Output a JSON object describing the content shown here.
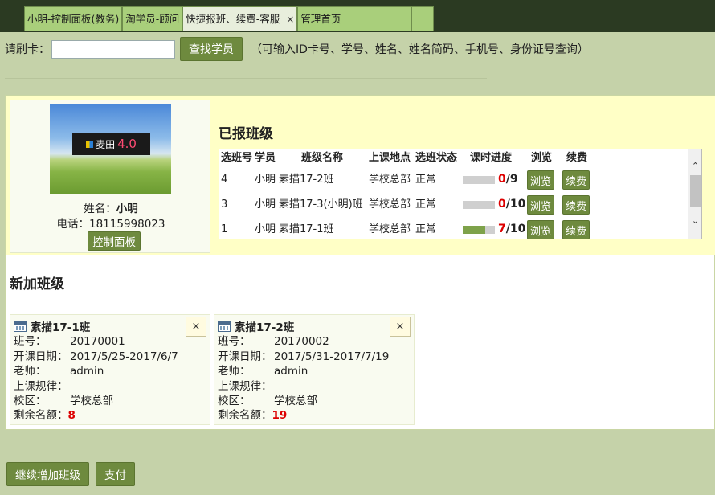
{
  "tabs": [
    {
      "label": "小明-控制面板(教务)",
      "active": false
    },
    {
      "label": "淘学员-顾问",
      "active": false
    },
    {
      "label": "快捷报班、续费-客服",
      "active": true,
      "close": "×"
    },
    {
      "label": "管理首页",
      "active": false
    },
    {
      "label": "",
      "active": false
    }
  ],
  "search": {
    "label": "请刷卡：",
    "value": "",
    "button": "查找学员",
    "hint": "（可输入ID卡号、学号、姓名、姓名简码、手机号、身份证号查询）"
  },
  "student": {
    "image_logo": "麦田",
    "image_version": "4.0",
    "name_label": "姓名：",
    "name": "小明",
    "phone_label": "电话：",
    "phone": "18115998023",
    "panel_button": "控制面板"
  },
  "registered": {
    "title": "已报班级",
    "headers": [
      "选班号",
      "学员",
      "班级名称",
      "上课地点",
      "选班状态",
      "课时进度",
      "浏览",
      "续费"
    ],
    "rows": [
      {
        "no": "4",
        "student": "小明",
        "class": "素描17-2班",
        "location": "学校总部",
        "status": "正常",
        "done": "0",
        "total": "/9",
        "progress": 0.0,
        "view": "浏览",
        "renew": "续费"
      },
      {
        "no": "3",
        "student": "小明",
        "class": "素描17-3(小明)班",
        "location": "学校总部",
        "status": "正常",
        "done": "0",
        "total": "/10",
        "progress": 0.0,
        "view": "浏览",
        "renew": "续费"
      },
      {
        "no": "1",
        "student": "小明",
        "class": "素描17-1班",
        "location": "学校总部",
        "status": "正常",
        "done": "7",
        "total": "/10",
        "progress": 0.7,
        "view": "浏览",
        "renew": "续费"
      }
    ]
  },
  "new_classes": {
    "title": "新加班级",
    "cards": [
      {
        "name": "素描17-1班",
        "close": "×",
        "no_label": "班号：",
        "no": "20170001",
        "dates_label": "开课日期：",
        "dates": "2017/5/25-2017/6/7",
        "teacher_label": "老师：",
        "teacher": "admin",
        "rule_label": "上课规律：",
        "rule": "",
        "campus_label": "校区：",
        "campus": "学校总部",
        "remain_label": "剩余名额：",
        "remain": "8"
      },
      {
        "name": "素描17-2班",
        "close": "×",
        "no_label": "班号：",
        "no": "20170002",
        "dates_label": "开课日期：",
        "dates": "2017/5/31-2017/7/19",
        "teacher_label": "老师：",
        "teacher": "admin",
        "rule_label": "上课规律：",
        "rule": "",
        "campus_label": "校区：",
        "campus": "学校总部",
        "remain_label": "剩余名额：",
        "remain": "19"
      }
    ]
  },
  "actions": {
    "add_more": "继续增加班级",
    "pay": "支付"
  },
  "colors": {
    "accent": "#6e8a3e",
    "tab": "#a9cf7b",
    "background": "#c5d2a9",
    "highlight_bg": "#ffffc6",
    "red": "#dd0000"
  }
}
